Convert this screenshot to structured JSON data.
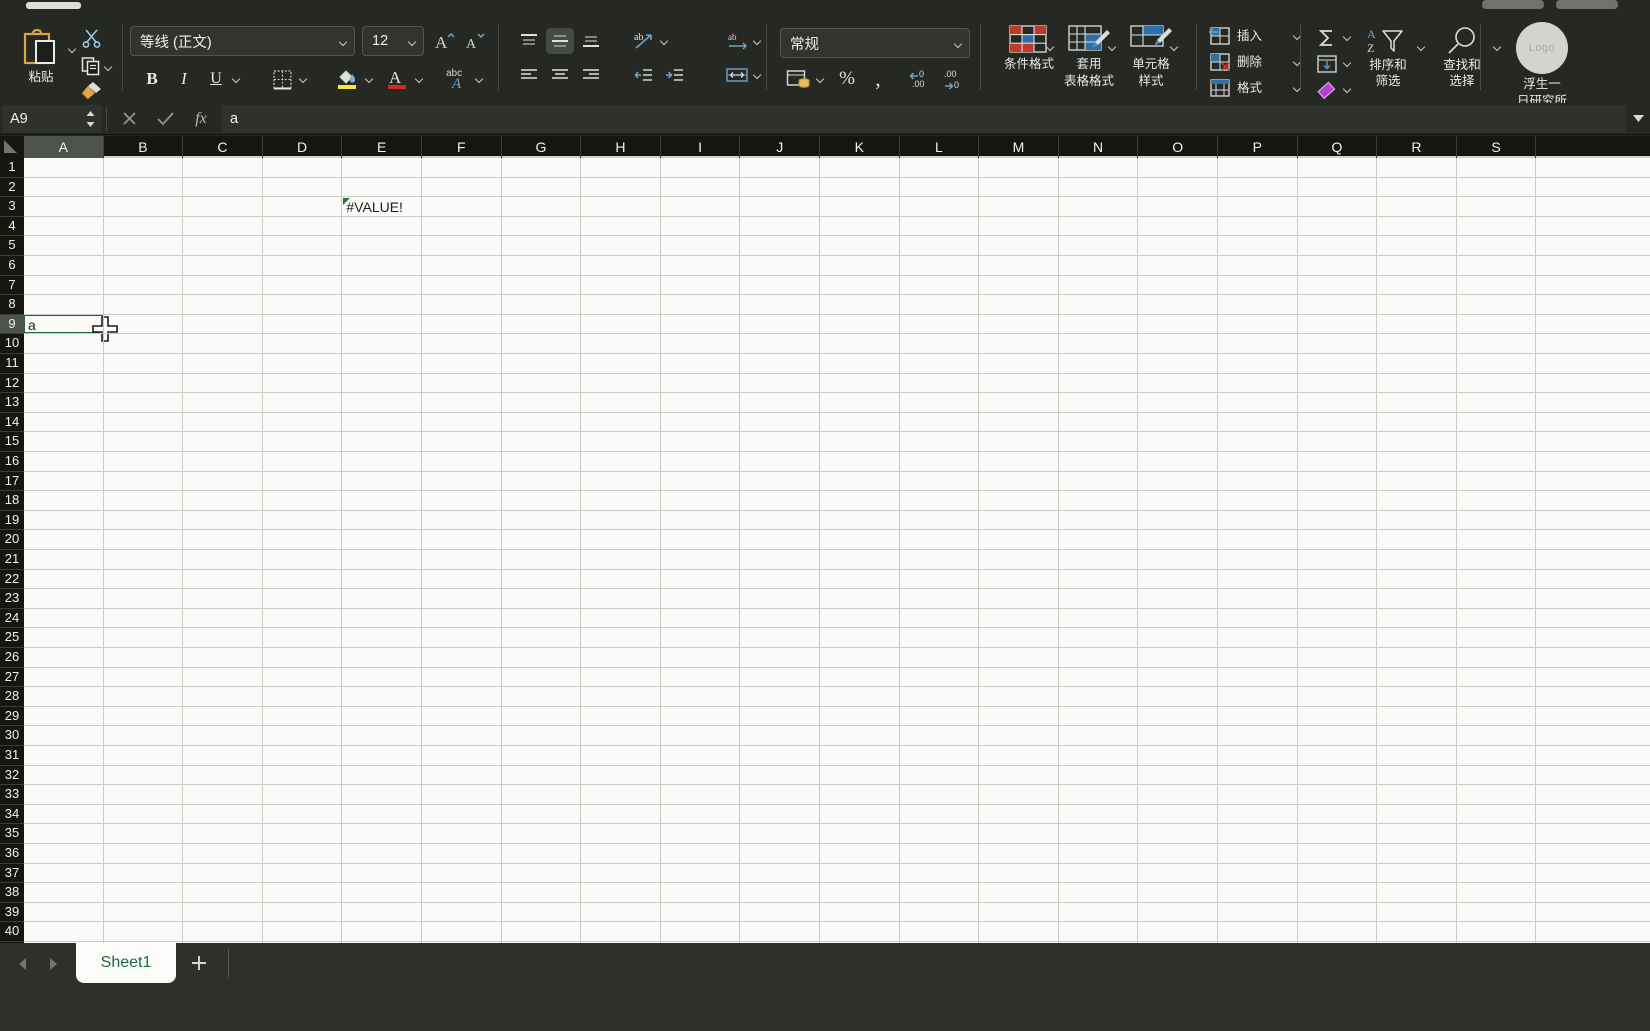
{
  "app": {
    "theme_bg": "#262824",
    "accent_green": "#1e6b43",
    "grid_bg": "#fafbf8"
  },
  "chrome": {
    "left_pill": "",
    "right_pill_1": "",
    "right_pill_2": ""
  },
  "ribbon": {
    "clipboard": {
      "paste_label": "粘贴",
      "paste_icon": "clipboard-icon",
      "cut_icon": "scissors-icon",
      "copy_icon": "copy-icon",
      "format_painter_icon": "paintbrush-icon"
    },
    "font": {
      "name_value": "等线 (正文)",
      "size_value": "12",
      "grow_label": "A",
      "shrink_label": "A",
      "bold_label": "B",
      "italic_label": "I",
      "underline_label": "U",
      "borders_icon": "borders-icon",
      "fill_color_icon": "fill-color-icon",
      "fill_color_swatch": "#f5e63c",
      "font_color_icon": "font-color-icon",
      "font_color_swatch": "#d42a20",
      "phonetic_label": "abc"
    },
    "alignment": {
      "align_top_icon": "align-top-icon",
      "align_middle_icon": "align-middle-icon",
      "align_bottom_icon": "align-bottom-icon",
      "orientation_icon": "text-orientation-icon",
      "align_left_icon": "align-left-icon",
      "align_center_icon": "align-center-icon",
      "align_right_icon": "align-right-icon",
      "decrease_indent_icon": "decrease-indent-icon",
      "increase_indent_icon": "increase-indent-icon",
      "wrap_text_icon": "wrap-text-icon",
      "merge_cells_icon": "merge-cells-icon"
    },
    "number": {
      "format_value": "常规",
      "currency_icon": "currency-icon",
      "percent_label": "%",
      "comma_label": " ",
      "increase_decimal_icon": "increase-decimal-icon",
      "decrease_decimal_icon": "decrease-decimal-icon"
    },
    "styles": {
      "conditional_label": "条件格式",
      "table_label_line1": "套用",
      "table_label_line2": "表格格式",
      "cellstyle_label_line1": "单元格",
      "cellstyle_label_line2": "样式"
    },
    "cells": {
      "insert_label": "插入",
      "delete_label": "删除",
      "format_label": "格式",
      "insert_icon": "insert-cells-icon",
      "delete_icon": "delete-cells-icon",
      "format_icon": "format-cells-icon"
    },
    "editing": {
      "autosum_icon": "sigma-icon",
      "fill_icon": "fill-down-icon",
      "clear_icon": "eraser-icon",
      "sort_label_line1": "排序和",
      "sort_label_line2": "筛选",
      "sort_icon": "sort-filter-icon",
      "find_label_line1": "查找和",
      "find_label_line2": "选择",
      "find_icon": "magnifier-icon"
    },
    "brand": {
      "logo_text": "Logo",
      "name_line1": "浮生一",
      "name_line2": "日研究所"
    }
  },
  "formula_bar": {
    "name_box": "A9",
    "cancel_icon": "x-icon",
    "accept_icon": "check-icon",
    "fx_label": "fx",
    "value": "a",
    "expand_icon": "chevron-down-icon"
  },
  "grid": {
    "columns": [
      "A",
      "B",
      "C",
      "D",
      "E",
      "F",
      "G",
      "H",
      "I",
      "J",
      "K",
      "L",
      "M",
      "N",
      "O",
      "P",
      "Q",
      "R",
      "S"
    ],
    "selected_column": "A",
    "rows": [
      1,
      2,
      3,
      4,
      5,
      6,
      7,
      8,
      9,
      10,
      11,
      12,
      13,
      14,
      15,
      16,
      17,
      18,
      19,
      20,
      21,
      22,
      23,
      24,
      25,
      26,
      27,
      28,
      29,
      30,
      31,
      32,
      33,
      34,
      35,
      36,
      37,
      38,
      39,
      40
    ],
    "selected_row": 9,
    "cells": [
      {
        "ref": "E3",
        "col": 4,
        "row": 3,
        "value": "#VALUE!",
        "error_flag": true
      },
      {
        "ref": "A9",
        "col": 0,
        "row": 9,
        "value": "a",
        "error_flag": false
      }
    ],
    "active_cell": {
      "ref": "A9",
      "col": 0,
      "row": 9
    },
    "cursor": "cell-crosshair-cursor"
  },
  "sheet_bar": {
    "prev_icon": "triangle-left-icon",
    "next_icon": "triangle-right-icon",
    "tabs": [
      {
        "name": "Sheet1",
        "active": true
      }
    ],
    "add_label": "+"
  }
}
